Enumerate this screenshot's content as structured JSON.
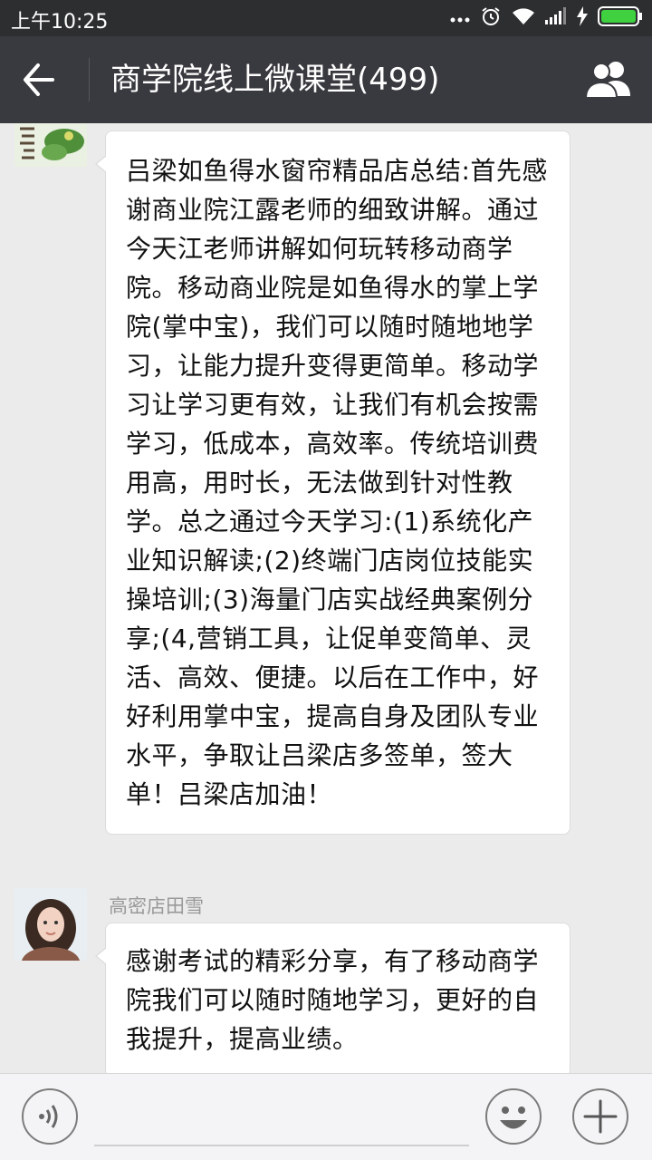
{
  "status_bar": {
    "time": "上午10:25"
  },
  "header": {
    "title": "商学院线上微课堂(499)"
  },
  "messages": [
    {
      "sender": "",
      "text": "吕梁如鱼得水窗帘精品店总结:首先感谢商业院江露老师的细致讲解。通过今天江老师讲解如何玩转移动商学院。移动商业院是如鱼得水的掌上学院(掌中宝)，我们可以随时随地地学习，让能力提升变得更简单。移动学习让学习更有效，让我们有机会按需学习，低成本，高效率。传统培训费用高，用时长，无法做到针对性教学。总之通过今天学习:(1)系统化产业知识解读;(2)终端门店岗位技能实操培训;(3)海量门店实战经典案例分享;(4,营销工具，让促单变简单、灵活、高效、便捷。以后在工作中，好好利用掌中宝，提高自身及团队专业水平，争取让吕梁店多签单，签大单！吕梁店加油！"
    },
    {
      "sender": "高密店田雪",
      "text": "感谢考试的精彩分享，有了移动商学院我们可以随时随地学习，更好的自我提升，提高业绩。"
    }
  ],
  "icons": [
    "more-dots-icon",
    "alarm-icon",
    "wifi-icon",
    "signal-icon",
    "charging-icon",
    "battery-icon",
    "back-arrow-icon",
    "group-members-icon",
    "voice-icon",
    "emoji-icon",
    "plus-icon"
  ],
  "colors": {
    "status_bar_bg": "#2d2e30",
    "header_bg": "#393a3f",
    "chat_bg": "#ebebeb",
    "battery_green": "#3fd13f"
  }
}
